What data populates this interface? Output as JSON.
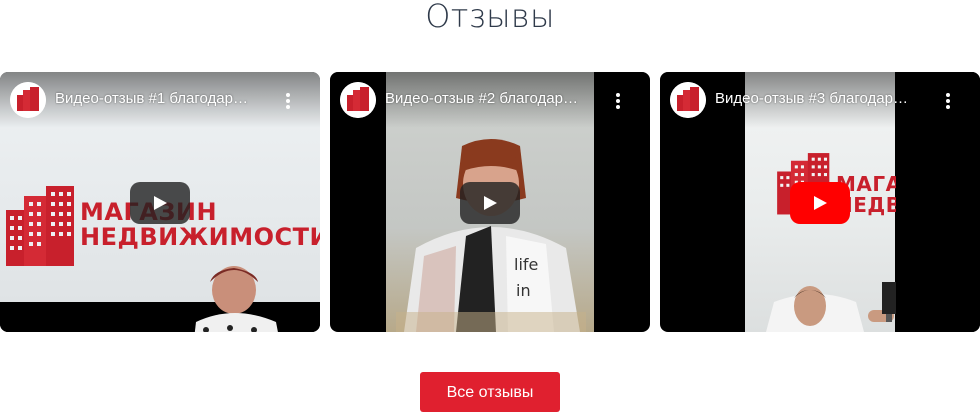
{
  "section": {
    "title": "Отзывы"
  },
  "videos": [
    {
      "title": "Видео-отзыв #1 благодар…",
      "play_style": "dark",
      "sign_line1": "МАГАЗИН",
      "sign_line2": "НЕДВИЖИМОСТИ"
    },
    {
      "title": "Видео-отзыв #2 благодар…",
      "play_style": "dark",
      "shirt_text": "life in"
    },
    {
      "title": "Видео-отзыв #3 благодар…",
      "play_style": "red",
      "sign_line1": "МАГАЗИН",
      "sign_line2": "НЕДВИ"
    }
  ],
  "actions": {
    "all_reviews_label": "Все отзывы"
  },
  "colors": {
    "brand_red": "#e0202f",
    "sign_red": "#c8202c",
    "title_text": "#2f3a4a",
    "youtube_red": "#ff0000"
  },
  "icons": [
    "channel-logo-icon",
    "more-vert-icon",
    "play-icon"
  ]
}
